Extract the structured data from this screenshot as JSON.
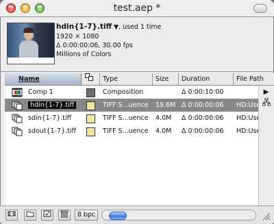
{
  "window": {
    "title": "test.aep *"
  },
  "preview": {
    "filename": "hdin{1-7}.tiff",
    "usage": ", used 1 time",
    "resolution": "1920 × 1080",
    "duration_fps": "Δ 0:00:00:06, 30.00 fps",
    "colors": "Millions of Colors"
  },
  "columns": {
    "name": "Name",
    "type": "Type",
    "size": "Size",
    "duration": "Duration",
    "file_path": "File Path"
  },
  "items": [
    {
      "name": "Comp 1",
      "label_color": "#6f6f6f",
      "type": "Composition",
      "size": "",
      "duration": "Δ 0:00:10:00",
      "file_path": "",
      "icon": "composition-icon"
    },
    {
      "name": "hdin{1-7}.tiff",
      "label_color": "#f2e7a0",
      "type": "TIFF S...uence",
      "size": "19.6M",
      "duration": "Δ 0:00:00:06",
      "file_path": "HD:User",
      "icon": "image-sequence-icon",
      "selected": true
    },
    {
      "name": "sdin{1-7}.tiff",
      "label_color": "#f2e7a0",
      "type": "TIFF S...uence",
      "size": "4.0M",
      "duration": "Δ 0:00:00:06",
      "file_path": "HD:User",
      "icon": "image-sequence-icon"
    },
    {
      "name": "sdout{1-7}.tiff",
      "label_color": "#f2e7a0",
      "type": "TIFF S...uence",
      "size": "4.0M",
      "duration": "Δ 0:00:00:06",
      "file_path": "HD:User",
      "icon": "image-sequence-icon"
    }
  ],
  "bottombar": {
    "bit_depth": "8 bpc"
  }
}
